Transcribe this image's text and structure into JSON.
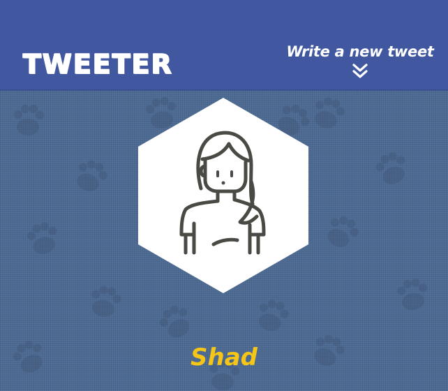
{
  "header": {
    "brand": "TWEETER",
    "compose_label": "Write a new tweet",
    "compose_icon": "chevron-double-down-icon"
  },
  "profile": {
    "avatar_icon": "woman-avatar-icon",
    "name": "Shad"
  },
  "colors": {
    "header_bg": "#4157a0",
    "page_bg": "#4d6a92",
    "name_color": "#f5c518",
    "avatar_stroke": "#4a4a44"
  }
}
